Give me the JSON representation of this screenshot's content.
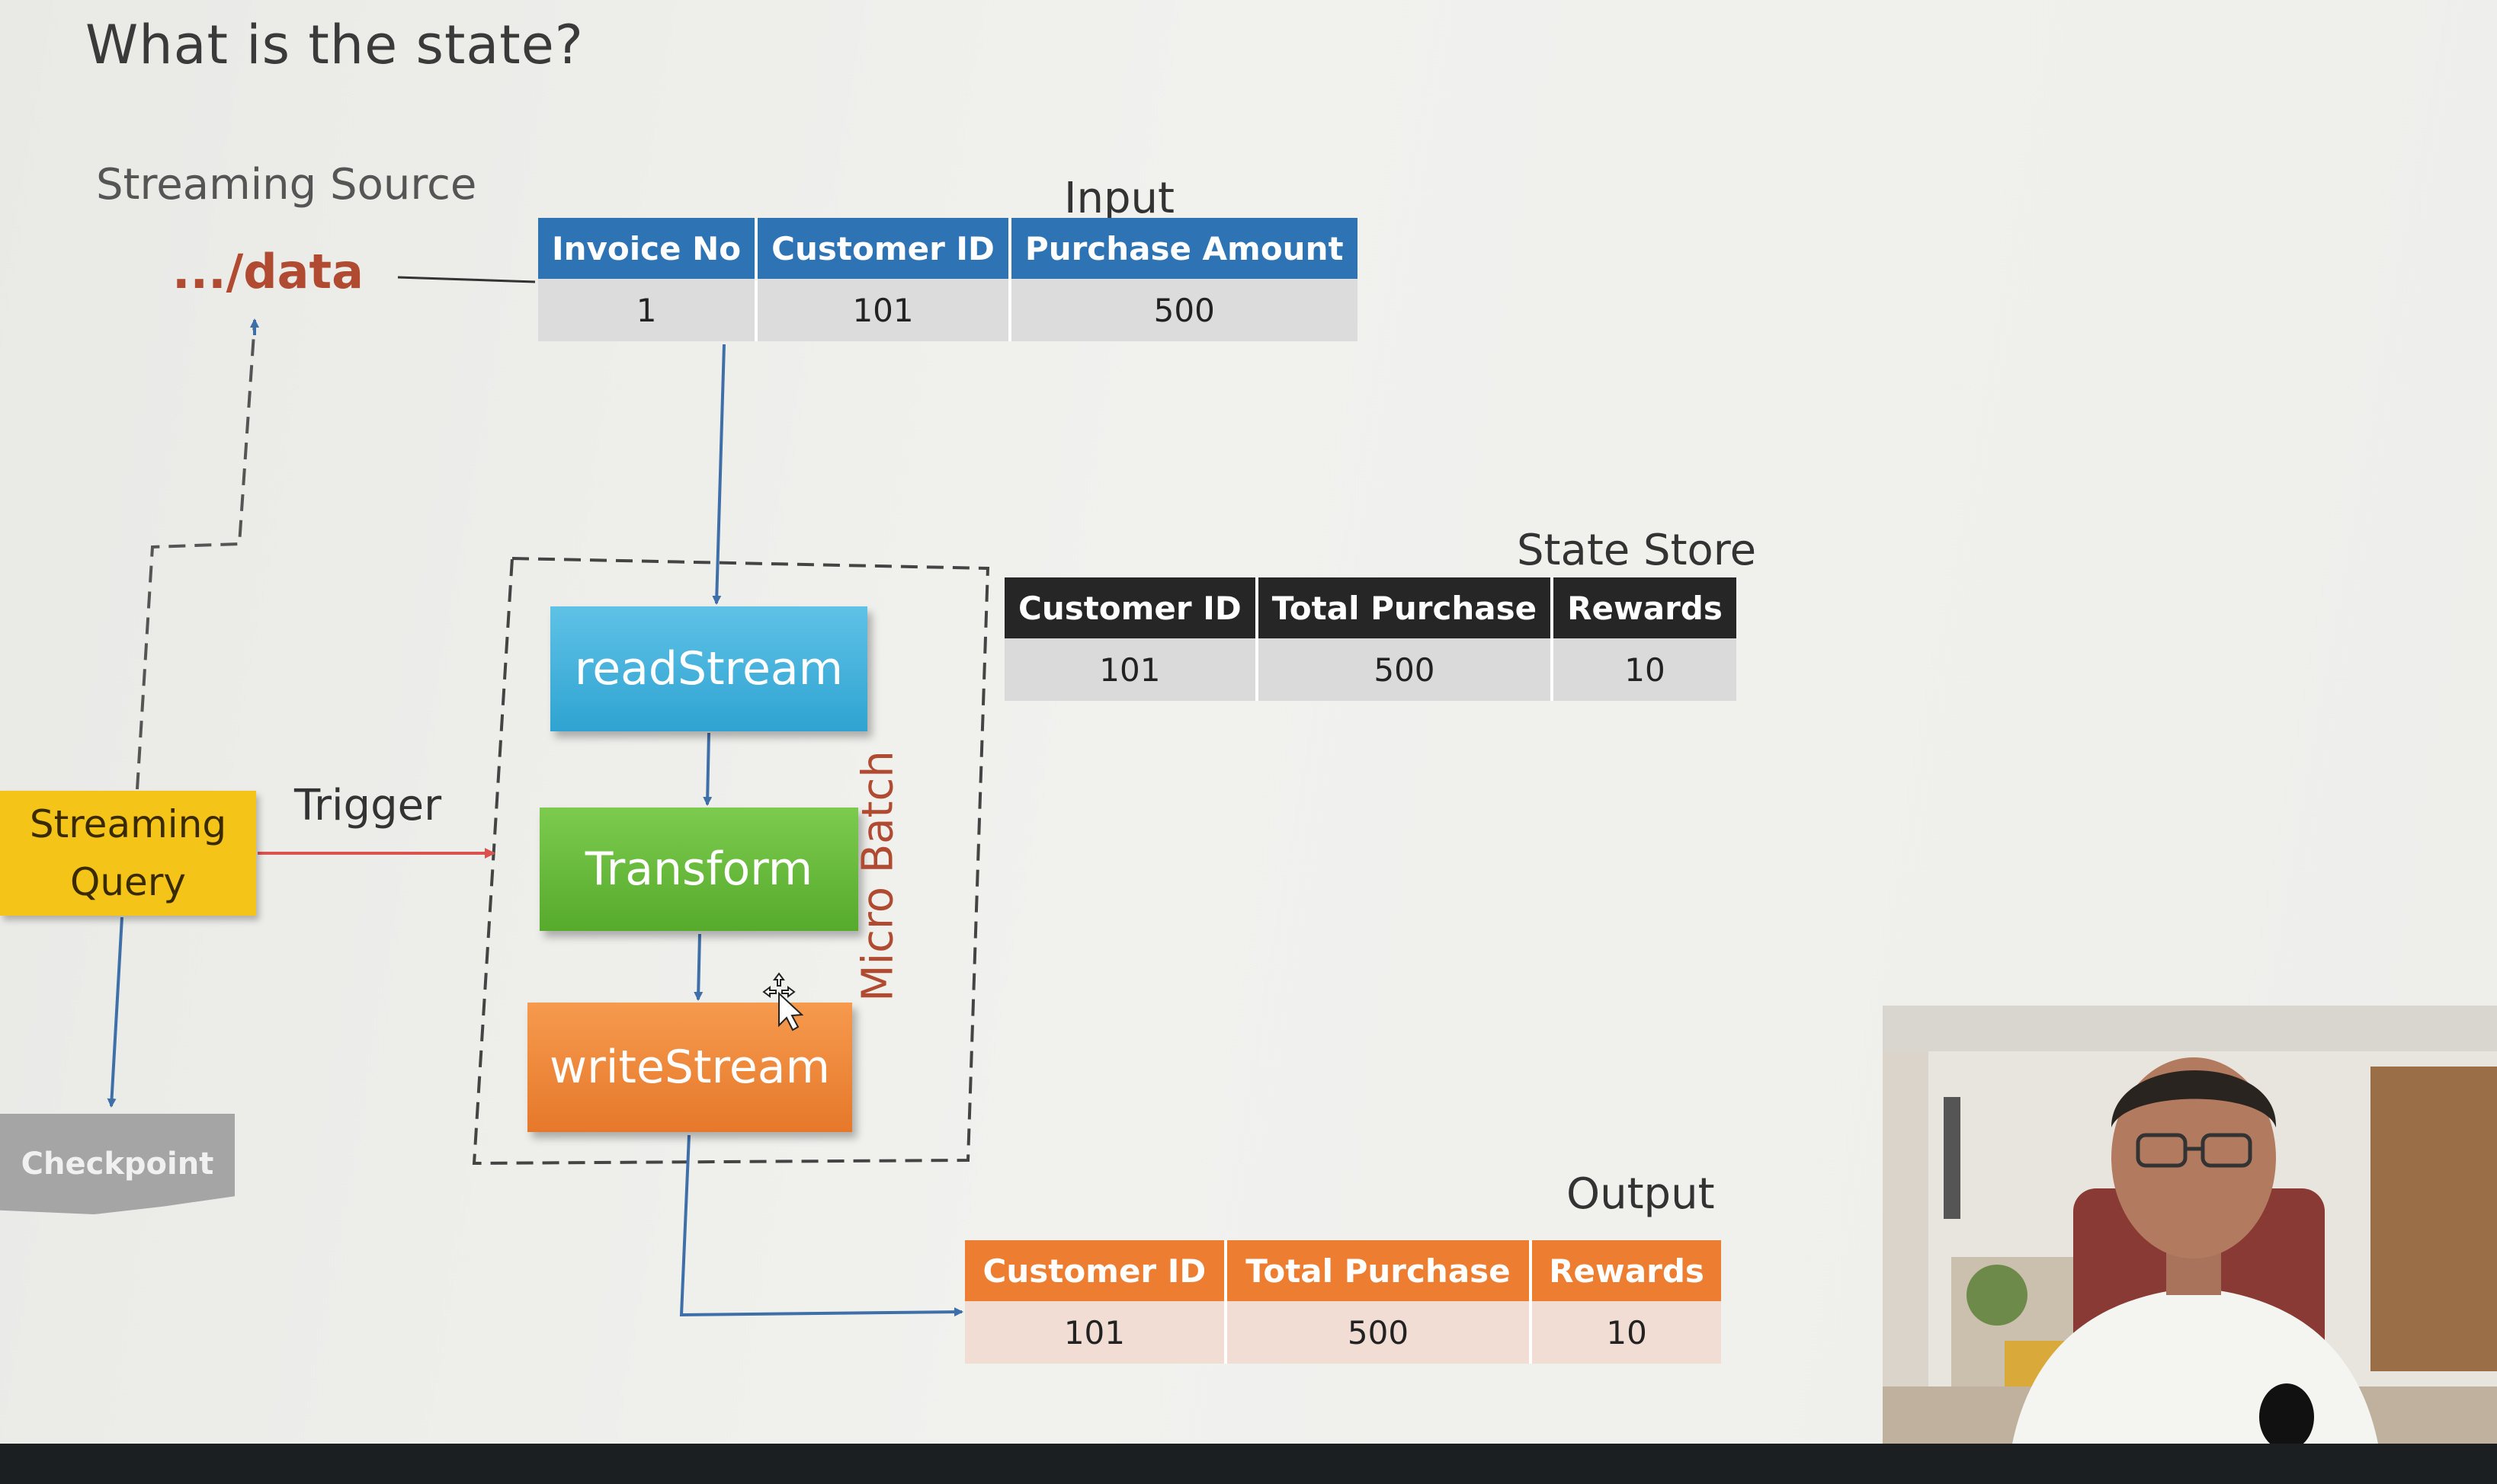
{
  "slide": {
    "title": "What is the state?",
    "streaming_source_label": "Streaming Source",
    "source_path": ".../data",
    "input_label": "Input",
    "state_store_label": "State Store",
    "output_label": "Output",
    "trigger_label": "Trigger",
    "micro_batch_label": "Micro Batch"
  },
  "input_table": {
    "headers": [
      "Invoice No",
      "Customer ID",
      "Purchase Amount"
    ],
    "rows": [
      [
        "1",
        "101",
        "500"
      ]
    ]
  },
  "state_table": {
    "headers": [
      "Customer ID",
      "Total Purchase",
      "Rewards"
    ],
    "rows": [
      [
        "101",
        "500",
        "10"
      ]
    ]
  },
  "output_table": {
    "headers": [
      "Customer ID",
      "Total Purchase",
      "Rewards"
    ],
    "rows": [
      [
        "101",
        "500",
        "10"
      ]
    ]
  },
  "process": {
    "read": "readStream",
    "transform": "Transform",
    "write": "writeStream"
  },
  "streaming_query": {
    "line1": "Streaming",
    "line2": "Query"
  },
  "checkpoint": "Checkpoint",
  "colors": {
    "input_header": "#2e74b5",
    "state_header": "#262626",
    "output_header": "#ed7d31",
    "read_box": "#3aaad8",
    "transform_box": "#62b536",
    "write_box": "#ee8435",
    "query_box": "#f4c518",
    "checkpoint_box": "#a5a5a5",
    "accent_text": "#b04a30",
    "trigger_arrow": "#d9534f",
    "flow_arrow": "#3f6fa8"
  },
  "icons": [
    "move-cursor-icon"
  ]
}
